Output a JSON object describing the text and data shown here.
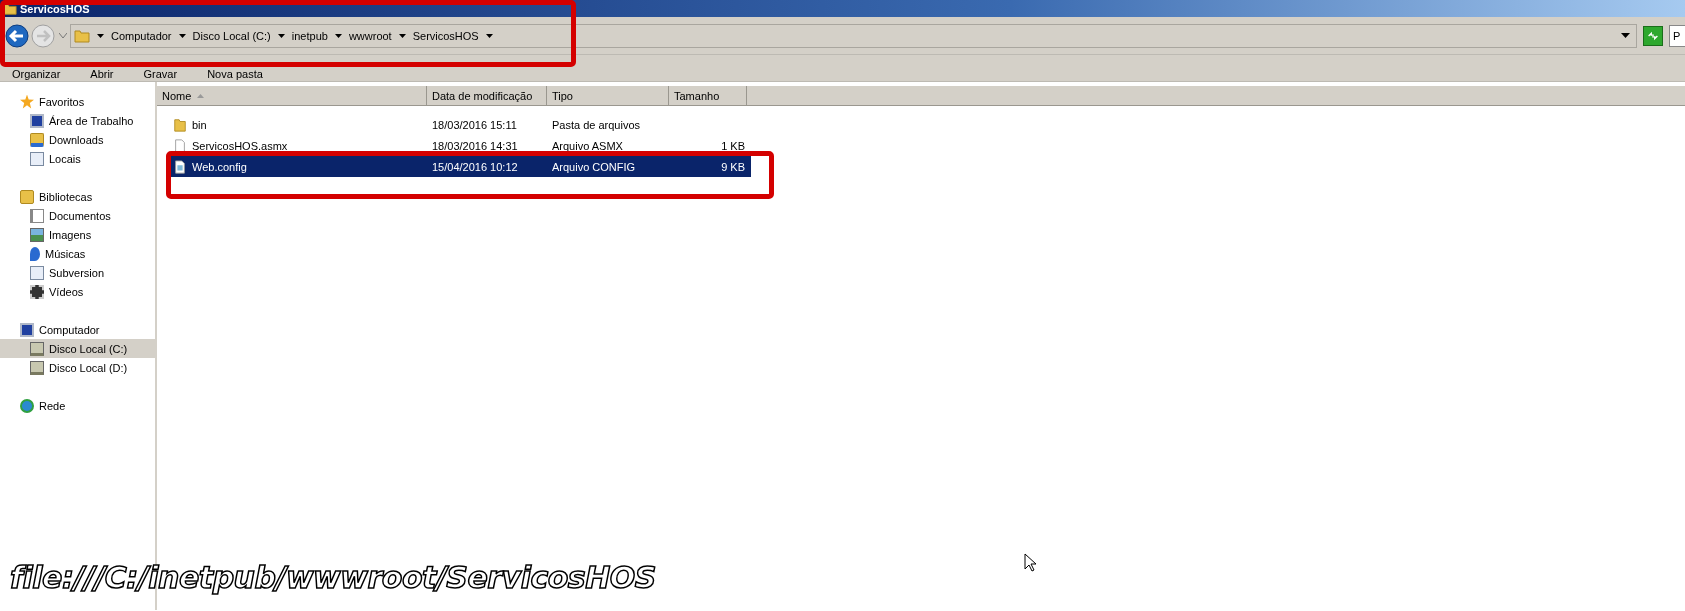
{
  "window": {
    "title": "ServicosHOS"
  },
  "address_bar": {
    "breadcrumbs": [
      "Computador",
      "Disco Local (C:)",
      "inetpub",
      "wwwroot",
      "ServicosHOS"
    ],
    "search": {
      "placeholder": "P"
    }
  },
  "toolbar": {
    "buttons": [
      "Organizar",
      "Abrir",
      "Gravar",
      "Nova pasta"
    ]
  },
  "sidebar": {
    "groups": [
      {
        "label": "Favoritos",
        "items": [
          {
            "label": "Área de Trabalho",
            "selected": false
          },
          {
            "label": "Downloads",
            "selected": false
          },
          {
            "label": "Locais",
            "selected": false
          }
        ]
      },
      {
        "label": "Bibliotecas",
        "items": [
          {
            "label": "Documentos",
            "selected": false
          },
          {
            "label": "Imagens",
            "selected": false
          },
          {
            "label": "Músicas",
            "selected": false
          },
          {
            "label": "Subversion",
            "selected": false
          },
          {
            "label": "Vídeos",
            "selected": false
          }
        ]
      },
      {
        "label": "Computador",
        "items": [
          {
            "label": "Disco Local (C:)",
            "selected": true
          },
          {
            "label": "Disco Local (D:)",
            "selected": false
          }
        ]
      },
      {
        "label": "Rede"
      }
    ]
  },
  "table": {
    "columns": [
      "Nome",
      "Data de modificação",
      "Tipo",
      "Tamanho"
    ],
    "rows": [
      {
        "kind": "folder",
        "name": "bin",
        "modified": "18/03/2016 15:11",
        "type": "Pasta de arquivos",
        "selected": false
      },
      {
        "kind": "file",
        "name": "ServicosHOS.asmx",
        "modified": "18/03/2016 14:31",
        "type": "Arquivo ASMX",
        "size": "1 KB",
        "selected": false
      },
      {
        "kind": "config",
        "name": "Web.config",
        "modified": "15/04/2016 10:12",
        "type": "Arquivo CONFIG",
        "size": "9 KB",
        "selected": true
      }
    ]
  },
  "annotation": {
    "caption": "file:///C:/inetpub/wwwroot/ServicosHOS"
  }
}
